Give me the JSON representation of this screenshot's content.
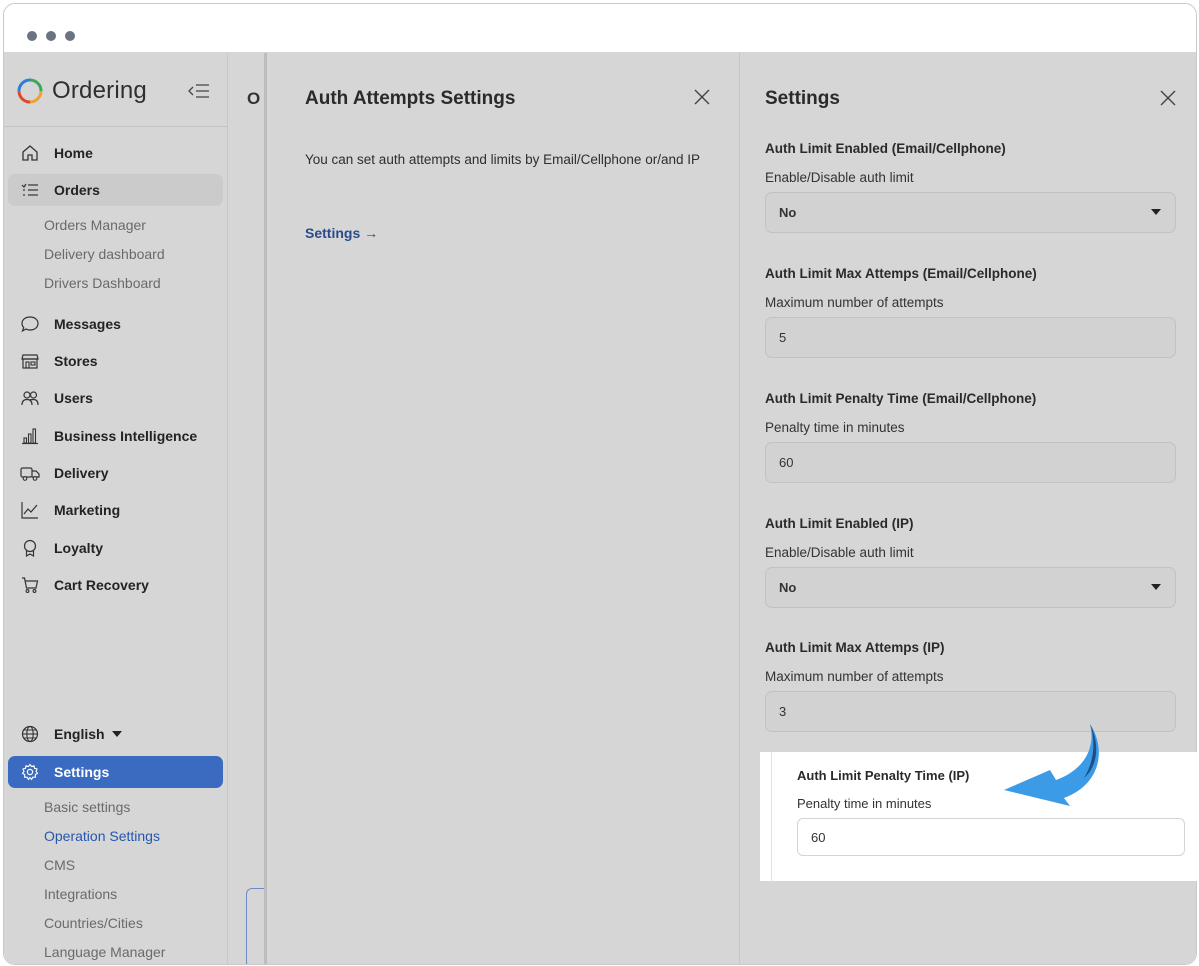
{
  "app": {
    "brand": "Ordering"
  },
  "background_page": {
    "title_fragment": "O"
  },
  "sidebar": {
    "items": [
      {
        "label": "Home",
        "icon": "home-icon"
      },
      {
        "label": "Orders",
        "icon": "list-icon"
      },
      {
        "label": "Messages",
        "icon": "chat-icon"
      },
      {
        "label": "Stores",
        "icon": "store-icon"
      },
      {
        "label": "Users",
        "icon": "users-icon"
      },
      {
        "label": "Business Intelligence",
        "icon": "bar-chart-icon"
      },
      {
        "label": "Delivery",
        "icon": "truck-icon"
      },
      {
        "label": "Marketing",
        "icon": "trend-icon"
      },
      {
        "label": "Loyalty",
        "icon": "badge-icon"
      },
      {
        "label": "Cart Recovery",
        "icon": "cart-icon"
      }
    ],
    "orders_sub": [
      "Orders Manager",
      "Delivery dashboard",
      "Drivers Dashboard"
    ],
    "language": "English",
    "settings_label": "Settings",
    "settings_sub": [
      "Basic settings",
      "Operation Settings",
      "CMS",
      "Integrations",
      "Countries/Cities",
      "Language Manager"
    ]
  },
  "auth_panel": {
    "title": "Auth Attempts Settings",
    "description": "You can set auth attempts and limits by Email/Cellphone or/and IP",
    "link": "Settings →"
  },
  "settings_panel": {
    "title": "Settings",
    "fields": [
      {
        "label": "Auth Limit Enabled (Email/Cellphone)",
        "sub": "Enable/Disable auth limit",
        "value": "No",
        "type": "select"
      },
      {
        "label": "Auth Limit Max Attemps (Email/Cellphone)",
        "sub": "Maximum number of attempts",
        "value": "5",
        "type": "input"
      },
      {
        "label": "Auth Limit Penalty Time (Email/Cellphone)",
        "sub": "Penalty time in minutes",
        "value": "60",
        "type": "input"
      },
      {
        "label": "Auth Limit Enabled (IP)",
        "sub": "Enable/Disable auth limit",
        "value": "No",
        "type": "select"
      },
      {
        "label": "Auth Limit Max Attemps (IP)",
        "sub": "Maximum number of attempts",
        "value": "3",
        "type": "input"
      }
    ],
    "highlight": {
      "label": "Auth Limit Penalty Time (IP)",
      "sub": "Penalty time in minutes",
      "value": "60"
    }
  },
  "colors": {
    "accent": "#3a6bc0",
    "link": "#2557b0",
    "arrow_light": "#3c9be6",
    "arrow_dark": "#1d4f86"
  }
}
